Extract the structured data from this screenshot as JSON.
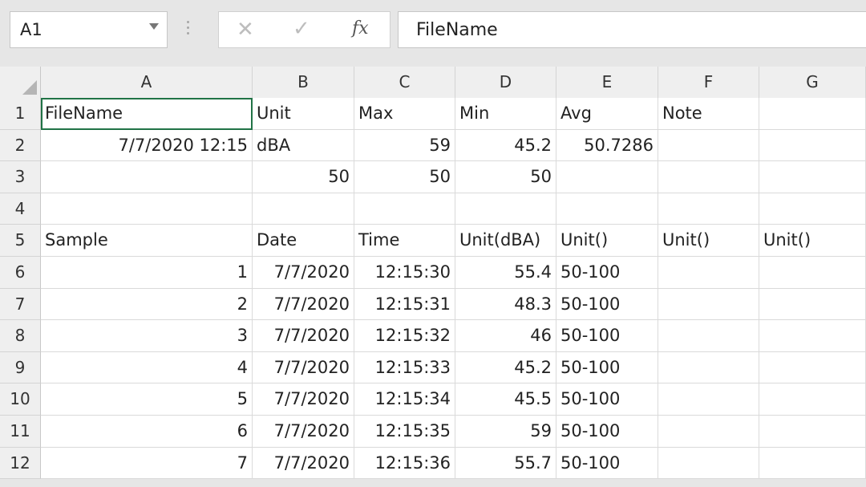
{
  "name_box": "A1",
  "formula_bar": {
    "cancel_icon": "✕",
    "enter_icon": "✓",
    "fx_label": "fx",
    "content": "FileName"
  },
  "columns": [
    "A",
    "B",
    "C",
    "D",
    "E",
    "F",
    "G"
  ],
  "rows": [
    {
      "n": "1",
      "cells": [
        {
          "v": "FileName",
          "t": "txt"
        },
        {
          "v": "Unit",
          "t": "txt"
        },
        {
          "v": "Max",
          "t": "txt"
        },
        {
          "v": "Min",
          "t": "txt"
        },
        {
          "v": "Avg",
          "t": "txt"
        },
        {
          "v": "Note",
          "t": "txt"
        },
        {
          "v": "",
          "t": "txt"
        }
      ]
    },
    {
      "n": "2",
      "cells": [
        {
          "v": "7/7/2020 12:15",
          "t": "num"
        },
        {
          "v": "dBA",
          "t": "txt"
        },
        {
          "v": "59",
          "t": "num"
        },
        {
          "v": "45.2",
          "t": "num"
        },
        {
          "v": "50.7286",
          "t": "num"
        },
        {
          "v": "",
          "t": "txt"
        },
        {
          "v": "",
          "t": "txt"
        }
      ]
    },
    {
      "n": "3",
      "cells": [
        {
          "v": "",
          "t": "txt"
        },
        {
          "v": "50",
          "t": "num"
        },
        {
          "v": "50",
          "t": "num"
        },
        {
          "v": "50",
          "t": "num"
        },
        {
          "v": "",
          "t": "txt"
        },
        {
          "v": "",
          "t": "txt"
        },
        {
          "v": "",
          "t": "txt"
        }
      ]
    },
    {
      "n": "4",
      "cells": [
        {
          "v": "",
          "t": "txt"
        },
        {
          "v": "",
          "t": "txt"
        },
        {
          "v": "",
          "t": "txt"
        },
        {
          "v": "",
          "t": "txt"
        },
        {
          "v": "",
          "t": "txt"
        },
        {
          "v": "",
          "t": "txt"
        },
        {
          "v": "",
          "t": "txt"
        }
      ]
    },
    {
      "n": "5",
      "cells": [
        {
          "v": "Sample",
          "t": "txt"
        },
        {
          "v": "Date",
          "t": "txt"
        },
        {
          "v": "Time",
          "t": "txt"
        },
        {
          "v": "Unit(dBA)",
          "t": "txt"
        },
        {
          "v": "Unit()",
          "t": "txt"
        },
        {
          "v": "Unit()",
          "t": "txt"
        },
        {
          "v": "Unit()",
          "t": "txt"
        }
      ]
    },
    {
      "n": "6",
      "cells": [
        {
          "v": "1",
          "t": "num"
        },
        {
          "v": "7/7/2020",
          "t": "num"
        },
        {
          "v": "12:15:30",
          "t": "num"
        },
        {
          "v": "55.4",
          "t": "num"
        },
        {
          "v": "50-100",
          "t": "txt"
        },
        {
          "v": "",
          "t": "txt"
        },
        {
          "v": "",
          "t": "txt"
        }
      ]
    },
    {
      "n": "7",
      "cells": [
        {
          "v": "2",
          "t": "num"
        },
        {
          "v": "7/7/2020",
          "t": "num"
        },
        {
          "v": "12:15:31",
          "t": "num"
        },
        {
          "v": "48.3",
          "t": "num"
        },
        {
          "v": "50-100",
          "t": "txt"
        },
        {
          "v": "",
          "t": "txt"
        },
        {
          "v": "",
          "t": "txt"
        }
      ]
    },
    {
      "n": "8",
      "cells": [
        {
          "v": "3",
          "t": "num"
        },
        {
          "v": "7/7/2020",
          "t": "num"
        },
        {
          "v": "12:15:32",
          "t": "num"
        },
        {
          "v": "46",
          "t": "num"
        },
        {
          "v": "50-100",
          "t": "txt"
        },
        {
          "v": "",
          "t": "txt"
        },
        {
          "v": "",
          "t": "txt"
        }
      ]
    },
    {
      "n": "9",
      "cells": [
        {
          "v": "4",
          "t": "num"
        },
        {
          "v": "7/7/2020",
          "t": "num"
        },
        {
          "v": "12:15:33",
          "t": "num"
        },
        {
          "v": "45.2",
          "t": "num"
        },
        {
          "v": "50-100",
          "t": "txt"
        },
        {
          "v": "",
          "t": "txt"
        },
        {
          "v": "",
          "t": "txt"
        }
      ]
    },
    {
      "n": "10",
      "cells": [
        {
          "v": "5",
          "t": "num"
        },
        {
          "v": "7/7/2020",
          "t": "num"
        },
        {
          "v": "12:15:34",
          "t": "num"
        },
        {
          "v": "45.5",
          "t": "num"
        },
        {
          "v": "50-100",
          "t": "txt"
        },
        {
          "v": "",
          "t": "txt"
        },
        {
          "v": "",
          "t": "txt"
        }
      ]
    },
    {
      "n": "11",
      "cells": [
        {
          "v": "6",
          "t": "num"
        },
        {
          "v": "7/7/2020",
          "t": "num"
        },
        {
          "v": "12:15:35",
          "t": "num"
        },
        {
          "v": "59",
          "t": "num"
        },
        {
          "v": "50-100",
          "t": "txt"
        },
        {
          "v": "",
          "t": "txt"
        },
        {
          "v": "",
          "t": "txt"
        }
      ]
    },
    {
      "n": "12",
      "cells": [
        {
          "v": "7",
          "t": "num"
        },
        {
          "v": "7/7/2020",
          "t": "num"
        },
        {
          "v": "12:15:36",
          "t": "num"
        },
        {
          "v": "55.7",
          "t": "num"
        },
        {
          "v": "50-100",
          "t": "txt"
        },
        {
          "v": "",
          "t": "txt"
        },
        {
          "v": "",
          "t": "txt"
        }
      ]
    }
  ],
  "colors": {
    "selection": "#217346",
    "header_bg": "#efefef",
    "toolbar_bg": "#e6e6e6"
  }
}
